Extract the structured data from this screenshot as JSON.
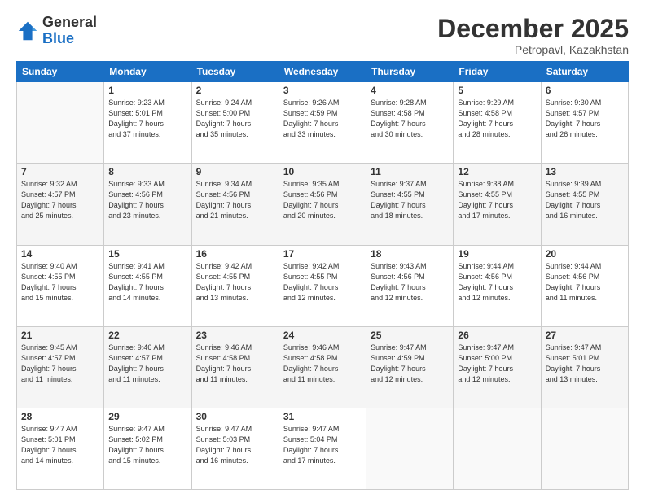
{
  "logo": {
    "general": "General",
    "blue": "Blue"
  },
  "header": {
    "month": "December 2025",
    "location": "Petropavl, Kazakhstan"
  },
  "days_of_week": [
    "Sunday",
    "Monday",
    "Tuesday",
    "Wednesday",
    "Thursday",
    "Friday",
    "Saturday"
  ],
  "weeks": [
    [
      {
        "day": "",
        "info": ""
      },
      {
        "day": "1",
        "info": "Sunrise: 9:23 AM\nSunset: 5:01 PM\nDaylight: 7 hours\nand 37 minutes."
      },
      {
        "day": "2",
        "info": "Sunrise: 9:24 AM\nSunset: 5:00 PM\nDaylight: 7 hours\nand 35 minutes."
      },
      {
        "day": "3",
        "info": "Sunrise: 9:26 AM\nSunset: 4:59 PM\nDaylight: 7 hours\nand 33 minutes."
      },
      {
        "day": "4",
        "info": "Sunrise: 9:28 AM\nSunset: 4:58 PM\nDaylight: 7 hours\nand 30 minutes."
      },
      {
        "day": "5",
        "info": "Sunrise: 9:29 AM\nSunset: 4:58 PM\nDaylight: 7 hours\nand 28 minutes."
      },
      {
        "day": "6",
        "info": "Sunrise: 9:30 AM\nSunset: 4:57 PM\nDaylight: 7 hours\nand 26 minutes."
      }
    ],
    [
      {
        "day": "7",
        "info": "Sunrise: 9:32 AM\nSunset: 4:57 PM\nDaylight: 7 hours\nand 25 minutes."
      },
      {
        "day": "8",
        "info": "Sunrise: 9:33 AM\nSunset: 4:56 PM\nDaylight: 7 hours\nand 23 minutes."
      },
      {
        "day": "9",
        "info": "Sunrise: 9:34 AM\nSunset: 4:56 PM\nDaylight: 7 hours\nand 21 minutes."
      },
      {
        "day": "10",
        "info": "Sunrise: 9:35 AM\nSunset: 4:56 PM\nDaylight: 7 hours\nand 20 minutes."
      },
      {
        "day": "11",
        "info": "Sunrise: 9:37 AM\nSunset: 4:55 PM\nDaylight: 7 hours\nand 18 minutes."
      },
      {
        "day": "12",
        "info": "Sunrise: 9:38 AM\nSunset: 4:55 PM\nDaylight: 7 hours\nand 17 minutes."
      },
      {
        "day": "13",
        "info": "Sunrise: 9:39 AM\nSunset: 4:55 PM\nDaylight: 7 hours\nand 16 minutes."
      }
    ],
    [
      {
        "day": "14",
        "info": "Sunrise: 9:40 AM\nSunset: 4:55 PM\nDaylight: 7 hours\nand 15 minutes."
      },
      {
        "day": "15",
        "info": "Sunrise: 9:41 AM\nSunset: 4:55 PM\nDaylight: 7 hours\nand 14 minutes."
      },
      {
        "day": "16",
        "info": "Sunrise: 9:42 AM\nSunset: 4:55 PM\nDaylight: 7 hours\nand 13 minutes."
      },
      {
        "day": "17",
        "info": "Sunrise: 9:42 AM\nSunset: 4:55 PM\nDaylight: 7 hours\nand 12 minutes."
      },
      {
        "day": "18",
        "info": "Sunrise: 9:43 AM\nSunset: 4:56 PM\nDaylight: 7 hours\nand 12 minutes."
      },
      {
        "day": "19",
        "info": "Sunrise: 9:44 AM\nSunset: 4:56 PM\nDaylight: 7 hours\nand 12 minutes."
      },
      {
        "day": "20",
        "info": "Sunrise: 9:44 AM\nSunset: 4:56 PM\nDaylight: 7 hours\nand 11 minutes."
      }
    ],
    [
      {
        "day": "21",
        "info": "Sunrise: 9:45 AM\nSunset: 4:57 PM\nDaylight: 7 hours\nand 11 minutes."
      },
      {
        "day": "22",
        "info": "Sunrise: 9:46 AM\nSunset: 4:57 PM\nDaylight: 7 hours\nand 11 minutes."
      },
      {
        "day": "23",
        "info": "Sunrise: 9:46 AM\nSunset: 4:58 PM\nDaylight: 7 hours\nand 11 minutes."
      },
      {
        "day": "24",
        "info": "Sunrise: 9:46 AM\nSunset: 4:58 PM\nDaylight: 7 hours\nand 11 minutes."
      },
      {
        "day": "25",
        "info": "Sunrise: 9:47 AM\nSunset: 4:59 PM\nDaylight: 7 hours\nand 12 minutes."
      },
      {
        "day": "26",
        "info": "Sunrise: 9:47 AM\nSunset: 5:00 PM\nDaylight: 7 hours\nand 12 minutes."
      },
      {
        "day": "27",
        "info": "Sunrise: 9:47 AM\nSunset: 5:01 PM\nDaylight: 7 hours\nand 13 minutes."
      }
    ],
    [
      {
        "day": "28",
        "info": "Sunrise: 9:47 AM\nSunset: 5:01 PM\nDaylight: 7 hours\nand 14 minutes."
      },
      {
        "day": "29",
        "info": "Sunrise: 9:47 AM\nSunset: 5:02 PM\nDaylight: 7 hours\nand 15 minutes."
      },
      {
        "day": "30",
        "info": "Sunrise: 9:47 AM\nSunset: 5:03 PM\nDaylight: 7 hours\nand 16 minutes."
      },
      {
        "day": "31",
        "info": "Sunrise: 9:47 AM\nSunset: 5:04 PM\nDaylight: 7 hours\nand 17 minutes."
      },
      {
        "day": "",
        "info": ""
      },
      {
        "day": "",
        "info": ""
      },
      {
        "day": "",
        "info": ""
      }
    ]
  ]
}
